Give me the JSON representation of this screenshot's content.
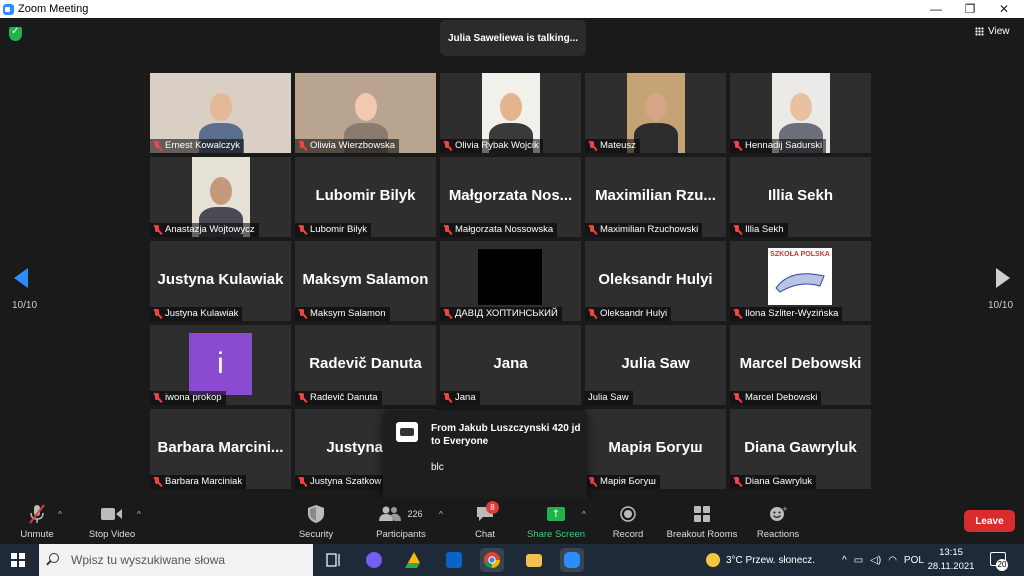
{
  "window": {
    "title": "Zoom Meeting",
    "min": "—",
    "max": "❐",
    "close": "✕"
  },
  "header": {
    "talking": "Julia Saweliewa is talking...",
    "view_label": "View"
  },
  "pagination": {
    "left_count": "10/10",
    "right_count": "10/10"
  },
  "tiles": [
    {
      "name": "Ernest Kowalczyk",
      "big": "",
      "muted": true
    },
    {
      "name": "Oliwia Wierzbowska",
      "big": "",
      "muted": true
    },
    {
      "name": "Olivia Rybak Wojcik",
      "big": "",
      "muted": true
    },
    {
      "name": "Mateusz",
      "big": "",
      "muted": true
    },
    {
      "name": "Hennadij Sadurski",
      "big": "",
      "muted": true
    },
    {
      "name": "Anastazja Wojtowycz",
      "big": "",
      "muted": true
    },
    {
      "name": "Lubomir Bilyk",
      "big": "Lubomir Bilyk",
      "muted": true
    },
    {
      "name": "Małgorzata Nossowska",
      "big": "Małgorzata  Nos...",
      "muted": true
    },
    {
      "name": "Maximilian Rzuchowski",
      "big": "Maximilian  Rzu...",
      "muted": true
    },
    {
      "name": "Illia Sekh",
      "big": "Illia Sekh",
      "muted": true
    },
    {
      "name": "Justyna Kulawiak",
      "big": "Justyna Kulawiak",
      "muted": true
    },
    {
      "name": "Maksym Salamon",
      "big": "Maksym Salamon",
      "muted": true
    },
    {
      "name": "ДАВІД ХОПТИНСЬКИЙ",
      "big": "",
      "muted": true
    },
    {
      "name": "Oleksandr Hulyi",
      "big": "Oleksandr Hulyi",
      "muted": true
    },
    {
      "name": "Ilona Szliter-Wyzińska",
      "big": "",
      "muted": true
    },
    {
      "name": "iwona prokop",
      "big": "",
      "muted": true
    },
    {
      "name": "Radevič Danuta",
      "big": "Radevič Danuta",
      "muted": true
    },
    {
      "name": "Jana",
      "big": "Jana",
      "muted": true
    },
    {
      "name": "Julia Saw",
      "big": "Julia Saw",
      "muted": false
    },
    {
      "name": "Marcel Debowski",
      "big": "Marcel Debowski",
      "muted": true
    },
    {
      "name": "Barbara Marciniak",
      "big": "Barbara  Marcini...",
      "muted": true
    },
    {
      "name": "Justyna Szatkow",
      "big": "Justyna  Sz",
      "muted": true
    },
    {
      "name": "",
      "big": "",
      "muted": false
    },
    {
      "name": "Марія Богуш",
      "big": "Марія Богуш",
      "muted": true
    },
    {
      "name": "Diana Gawryluk",
      "big": "Diana Gawryluk",
      "muted": true
    }
  ],
  "special_tiles": {
    "iwona_letter": "i",
    "school_logo": "SZKOŁA POLSKA"
  },
  "chat_popup": {
    "from": "From Jakub Luszczynski 420 jd to Everyone",
    "message": "blc"
  },
  "toolbar": {
    "unmute": "Unmute",
    "stop_video": "Stop Video",
    "security": "Security",
    "participants": "Participants",
    "participants_count": "226",
    "chat": "Chat",
    "chat_badge": "8",
    "share_screen": "Share Screen",
    "record": "Record",
    "breakout_rooms": "Breakout Rooms",
    "reactions": "Reactions",
    "leave": "Leave"
  },
  "taskbar": {
    "search_placeholder": "Wpisz tu wyszukiwane słowa",
    "weather": "3°C  Przew. słonecz.",
    "language": "POL",
    "time": "13:15",
    "date": "28.11.2021",
    "notifications": "20"
  },
  "colors": {
    "leave": "#d92d2d",
    "share": "#3dd17b",
    "accent": "#2d8cff"
  }
}
